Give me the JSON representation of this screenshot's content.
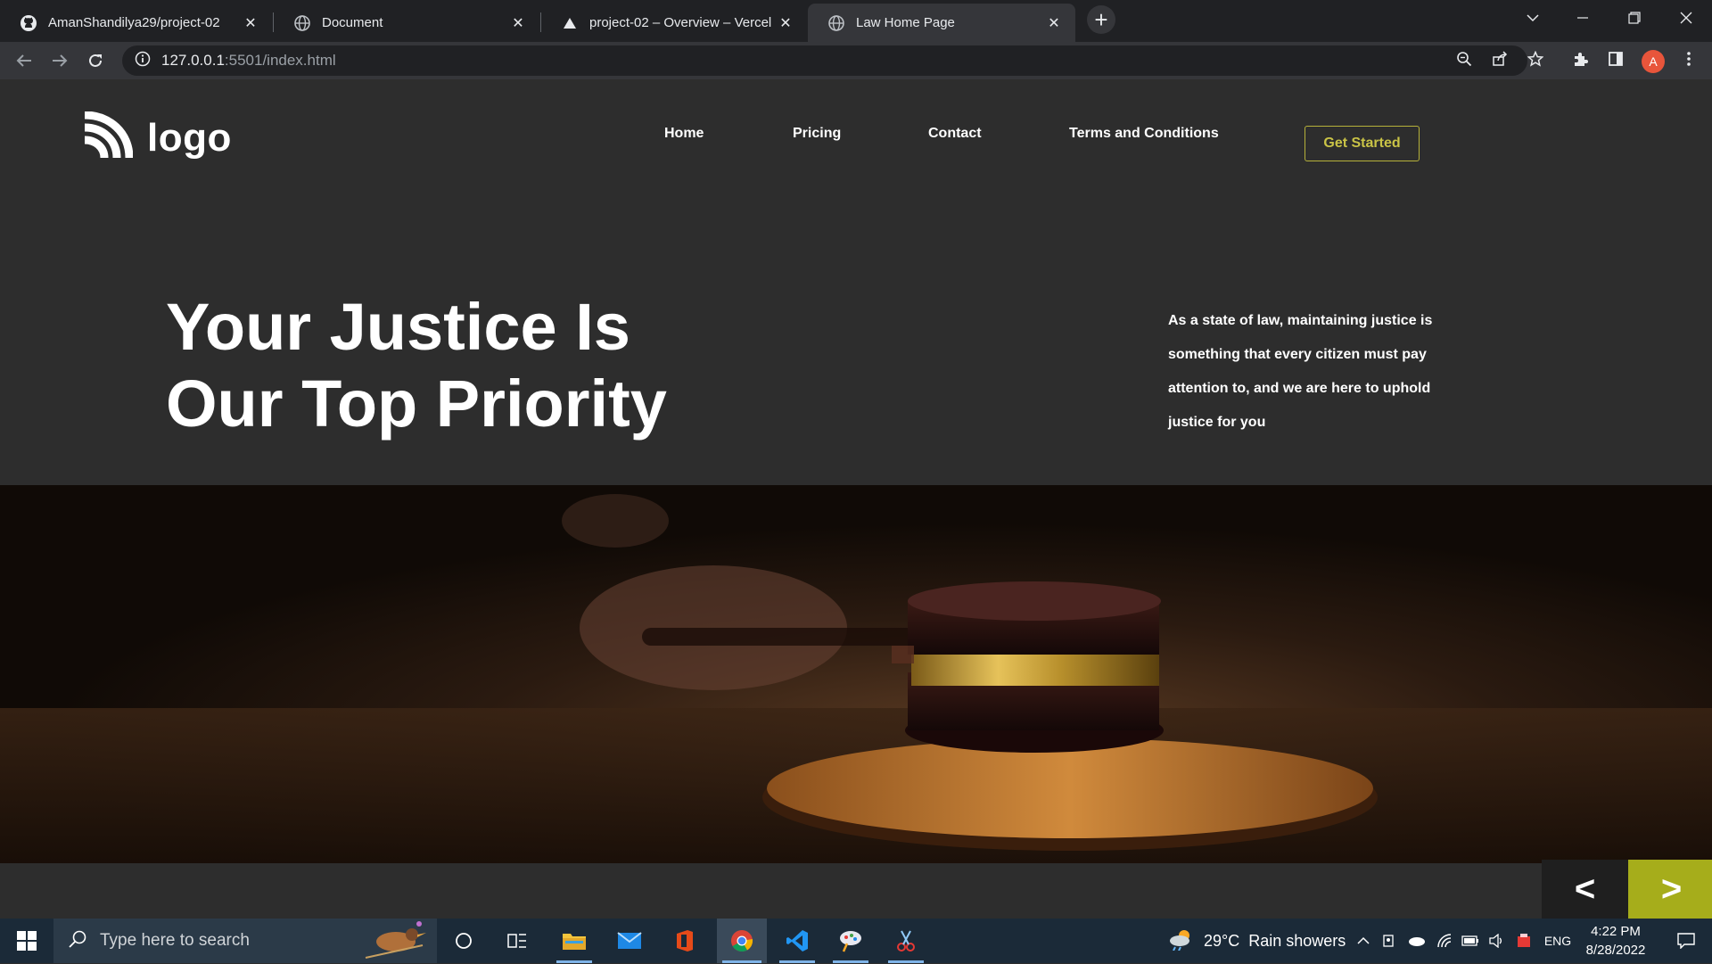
{
  "browser": {
    "tabs": [
      {
        "title": "AmanShandilya29/project-02",
        "icon": "github-icon"
      },
      {
        "title": "Document",
        "icon": "globe-icon"
      },
      {
        "title": "project-02 – Overview – Vercel",
        "icon": "vercel-icon"
      },
      {
        "title": "Law Home Page",
        "icon": "globe-icon",
        "active": true
      }
    ],
    "url_host": "127.0.0.1",
    "url_rest": ":5501/index.html",
    "profile_initial": "A"
  },
  "site": {
    "logo_text": "logo",
    "nav": [
      "Home",
      "Pricing",
      "Contact",
      "Terms and Conditions"
    ],
    "cta_label": "Get Started",
    "hero_title_line1": "Your Justice Is",
    "hero_title_line2": "Our Top Priority",
    "hero_description": "As a state of law, maintaining justice is something that every citizen must pay attention to, and we are here to uphold justice for you",
    "hero_image": "judge-gavel-image",
    "prev_label": "<",
    "next_label": ">",
    "colors": {
      "background": "#2d2d2d",
      "accent": "#a6ad1b",
      "cta_border": "#b6b13a"
    }
  },
  "taskbar": {
    "search_placeholder": "Type here to search",
    "weather": "29°C  Rain showers",
    "language": "ENG",
    "time": "4:22 PM",
    "date": "8/28/2022"
  }
}
